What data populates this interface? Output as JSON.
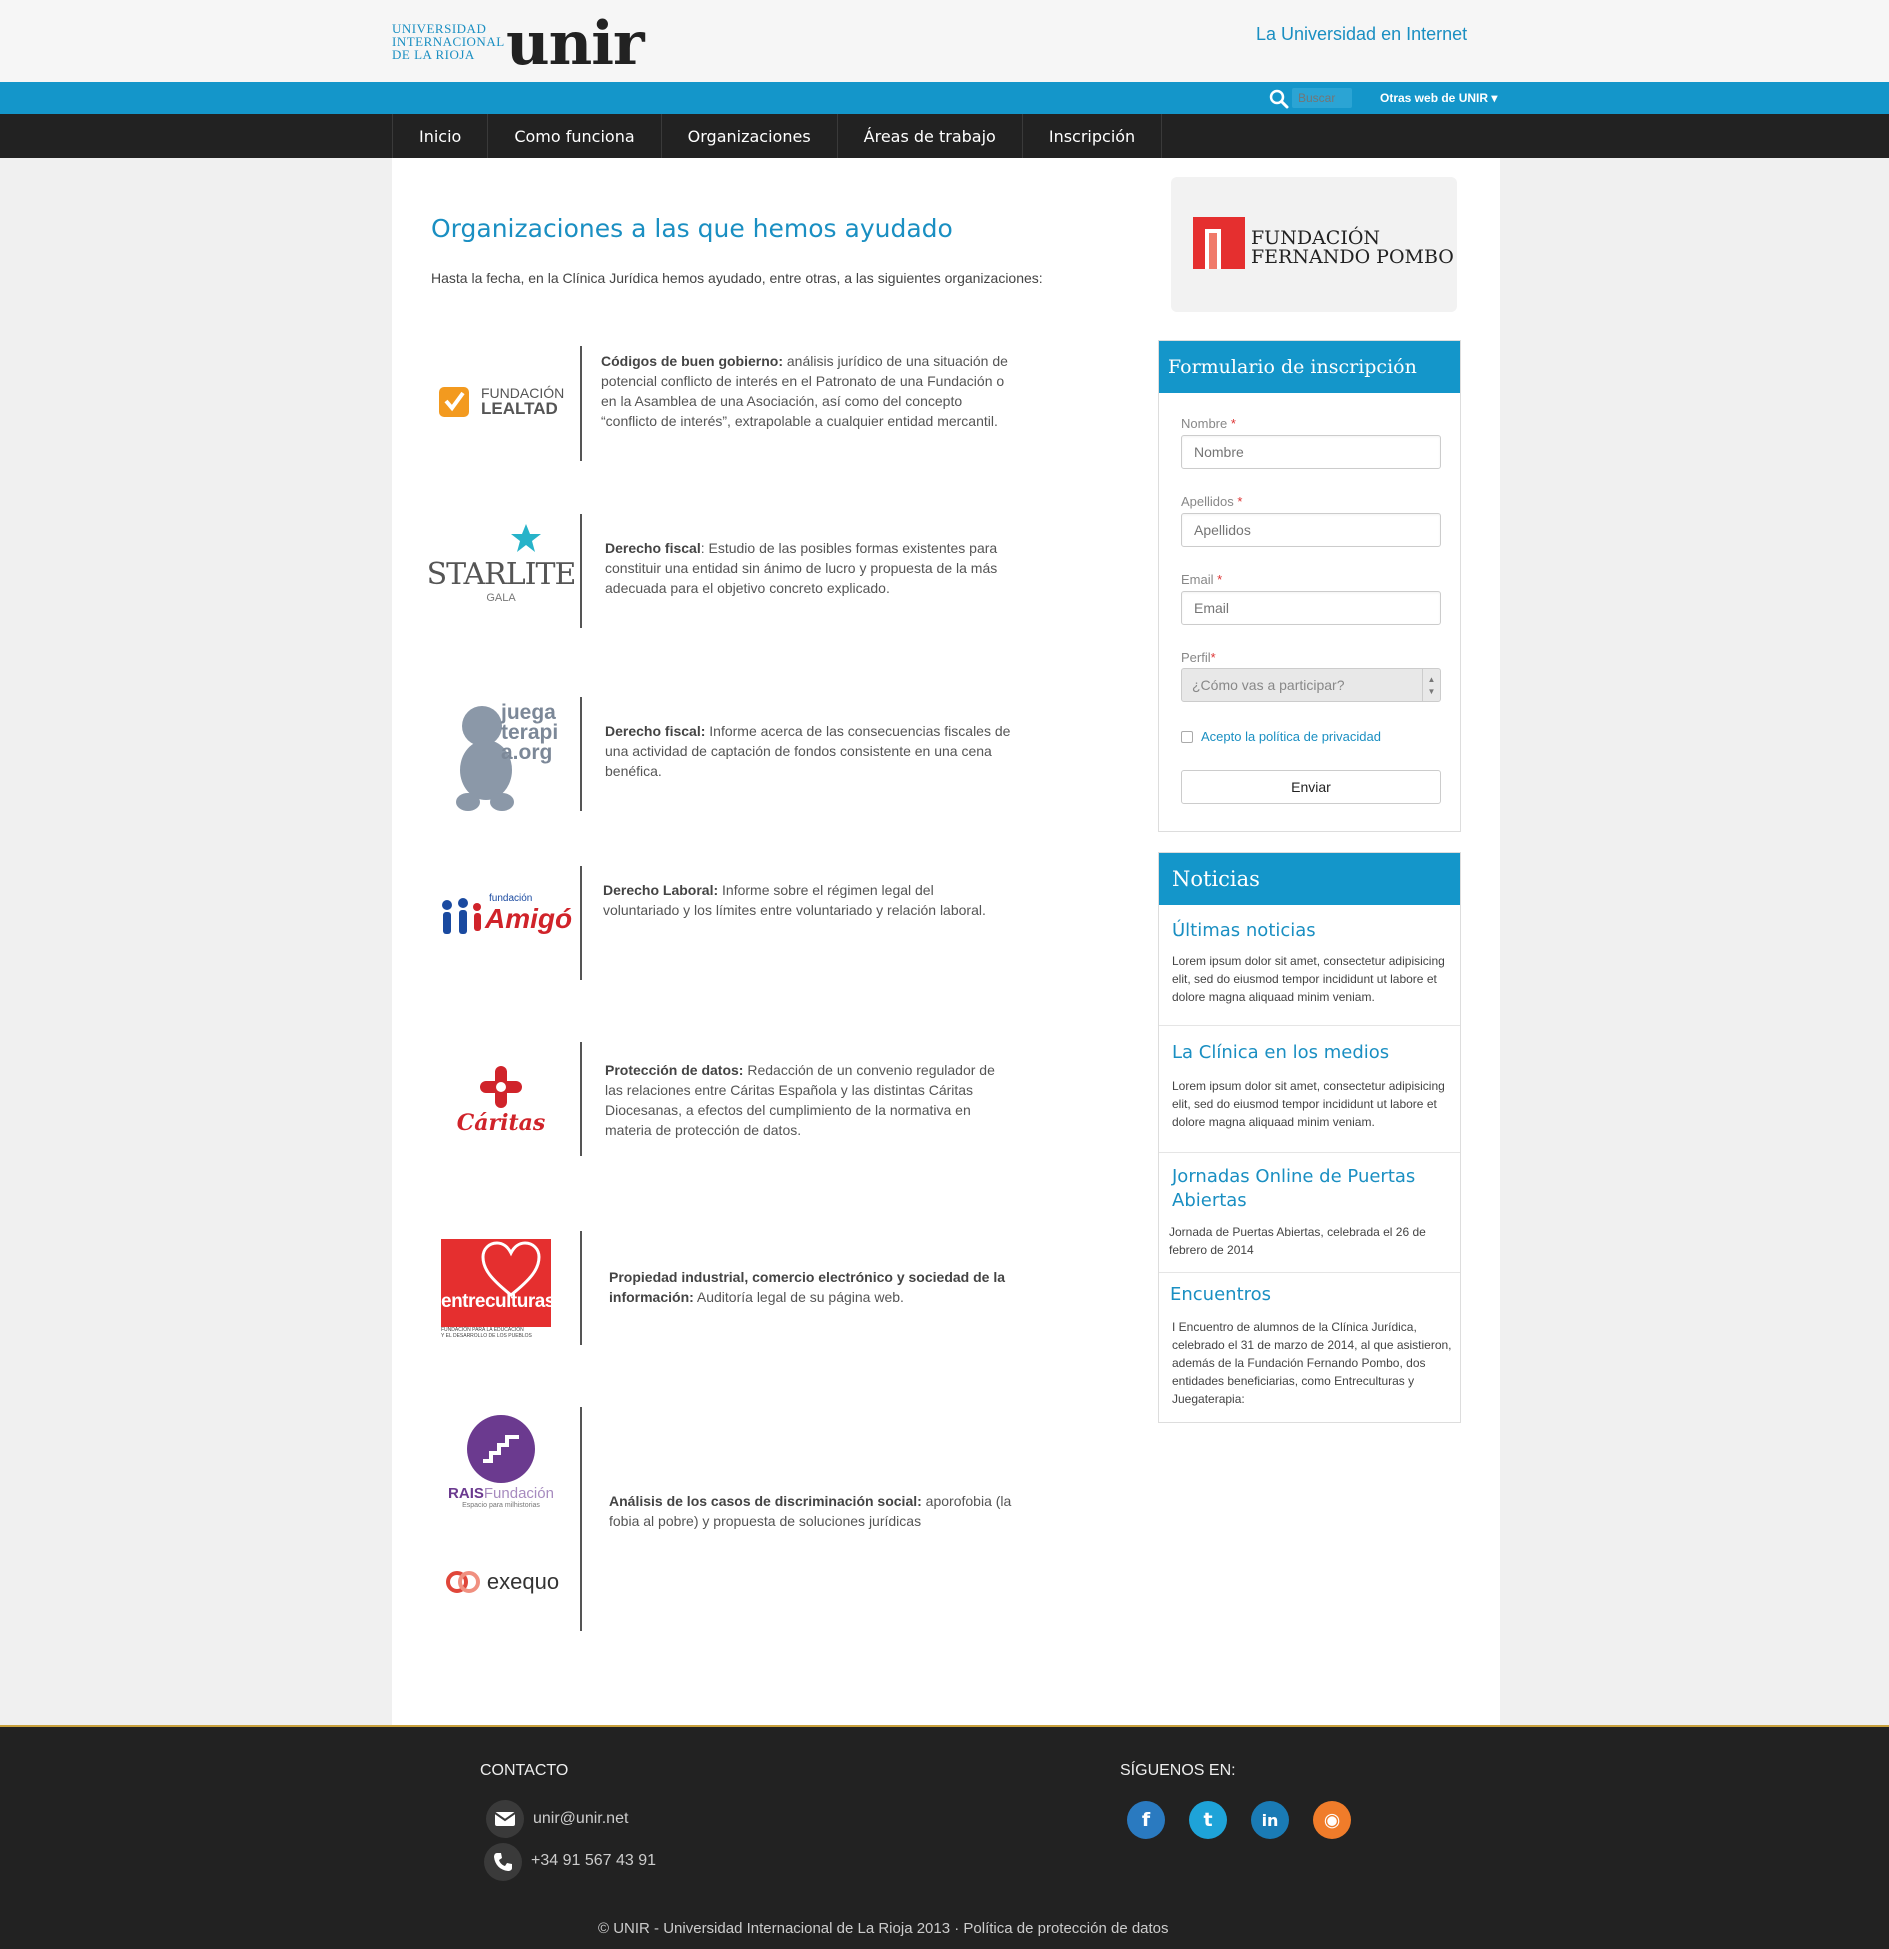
{
  "header": {
    "logo_small": [
      "UNIVERSIDAD",
      "INTERNACIONAL",
      "DE LA RIOJA"
    ],
    "logo_big": "unir",
    "tagline": "La Universidad en Internet",
    "search_placeholder": "Buscar",
    "other_webs": "Otras web de UNIR ▾"
  },
  "nav": [
    "Inicio",
    "Como funciona",
    "Organizaciones",
    "Áreas de trabajo",
    "Inscripción"
  ],
  "main": {
    "title": "Organizaciones a las que hemos ayudado",
    "intro": "Hasta la fecha, en la Clínica Jurídica hemos ayudado, entre otras, a las siguientes organizaciones:",
    "orgs": [
      {
        "logo": "FUNDACIÓN LEALTAD",
        "logo_lines": [
          "FUNDACIÓN",
          "LEALTAD"
        ],
        "title": "Códigos de buen gobierno:",
        "text": " análisis jurídico de una situación de potencial conflicto de interés en el Patronato de una Fundación o en la Asamblea de una Asociación, así como del concepto “conflicto de interés”, extrapolable a cualquier entidad mercantil."
      },
      {
        "logo": "STARLITE GALA",
        "logo_lines": [
          "STARLITE",
          "GALA"
        ],
        "title": "Derecho fiscal",
        "text": ": Estudio de las posibles formas existentes para constituir una entidad sin ánimo de lucro y propuesta de la más adecuada para el objetivo concreto explicado."
      },
      {
        "logo": "juegaterapia.org",
        "logo_lines": [
          "juega",
          "terapi",
          "a.org"
        ],
        "title": "Derecho fiscal:",
        "text": " Informe acerca de las consecuencias fiscales de una actividad de captación de fondos consistente en una cena benéfica."
      },
      {
        "logo": "fundación Amigó",
        "logo_lines": [
          "fundación",
          "Amigó"
        ],
        "title": "Derecho Laboral:",
        "text": " Informe sobre el régimen legal del voluntariado y los límites entre voluntariado y relación laboral."
      },
      {
        "logo": "Cáritas",
        "logo_lines": [
          "Cáritas"
        ],
        "title": "Protección de datos:",
        "text": " Redacción de un convenio regulador de las relaciones entre Cáritas Española y las distintas Cáritas Diocesanas, a efectos del cumplimiento de la normativa en materia de protección de datos."
      },
      {
        "logo": "entreculturas",
        "logo_lines": [
          "entreculturas",
          "FUNDACIÓN PARA LA EDUCACIÓN",
          "Y EL DESARROLLO DE LOS PUEBLOS"
        ],
        "title": "Propiedad industrial, comercio electrónico y sociedad de la información:",
        "text": " Auditoría legal de su página web."
      },
      {
        "logo": "RAIS Fundación / exequo",
        "logo_lines": [
          "RAIS",
          "Fundación",
          "Espacio para milhistorias",
          "exequo"
        ],
        "title": "Análisis de los casos de discriminación social:",
        "text": " aporofobia (la fobia al pobre) y propuesta de soluciones jurídicas"
      }
    ]
  },
  "sponsor": {
    "line1": "FUNDACIÓN",
    "line2": "FERNANDO POMBO"
  },
  "form": {
    "title": "Formulario de inscripción",
    "fields": [
      {
        "label": "Nombre",
        "placeholder": "Nombre"
      },
      {
        "label": "Apellidos",
        "placeholder": "Apellidos"
      },
      {
        "label": "Email",
        "placeholder": "Email"
      }
    ],
    "required_mark": "*",
    "profile_label": "Perfil",
    "profile_placeholder": "¿Cómo vas a participar?",
    "privacy": "Acepto la política de privacidad",
    "submit": "Enviar"
  },
  "news": {
    "title": "Noticias",
    "items": [
      {
        "title": "Últimas noticias",
        "text": "Lorem ipsum dolor sit amet, consectetur adipisicing elit, sed do eiusmod tempor incididunt ut labore et dolore magna aliquaad minim veniam."
      },
      {
        "title": "La Clínica en los medios",
        "text": "Lorem ipsum dolor sit amet, consectetur adipisicing elit, sed do eiusmod tempor incididunt ut labore et dolore magna aliquaad minim veniam."
      },
      {
        "title": "Jornadas Online de Puertas Abiertas",
        "text": "Jornada de Puertas Abiertas, celebrada el 26 de febrero de 2014"
      },
      {
        "title": "Encuentros",
        "text": "I Encuentro de alumnos de la Clínica Jurídica, celebrado el 31 de marzo de 2014, al que asistieron, además de la Fundación Fernando Pombo, dos entidades beneficiarias, como Entreculturas y Juegaterapia:"
      }
    ]
  },
  "footer": {
    "contact_title": "CONTACTO",
    "email": "unir@unir.net",
    "phone": "+34 91 567 43 91",
    "follow_title": "SÍGUENOS EN:",
    "social": [
      {
        "name": "facebook",
        "glyph": "f",
        "color": "#2a7ac0"
      },
      {
        "name": "twitter",
        "glyph": "t",
        "color": "#1ea3d8"
      },
      {
        "name": "linkedin",
        "glyph": "in",
        "color": "#1a7bb5"
      },
      {
        "name": "rss",
        "glyph": "◉",
        "color": "#f07c2a"
      }
    ],
    "copyright": "© UNIR - Universidad Internacional de La Rioja 2013 · Política de protección de datos"
  },
  "colors": {
    "accent": "#1496ca",
    "dark": "#222222"
  }
}
